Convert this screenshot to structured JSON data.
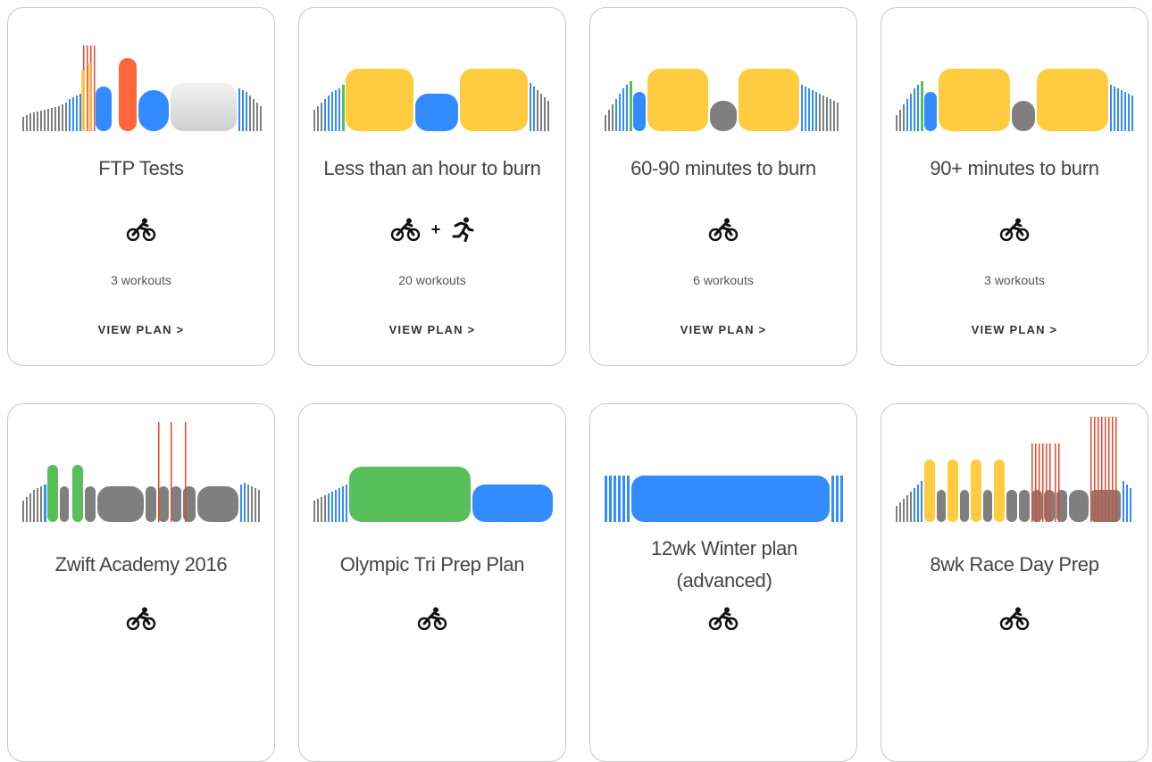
{
  "plans": [
    {
      "title": "FTP Tests",
      "sports": [
        "bike"
      ],
      "workouts": "3 workouts",
      "cta": "VIEW PLAN >"
    },
    {
      "title": "Less than an hour to burn",
      "sports": [
        "bike",
        "run"
      ],
      "workouts": "20 workouts",
      "cta": "VIEW PLAN >"
    },
    {
      "title": "60-90 minutes to burn",
      "sports": [
        "bike"
      ],
      "workouts": "6 workouts",
      "cta": "VIEW PLAN >"
    },
    {
      "title": "90+ minutes to burn",
      "sports": [
        "bike"
      ],
      "workouts": "3 workouts",
      "cta": "VIEW PLAN >"
    },
    {
      "title": "Zwift Academy 2016",
      "sports": [
        "bike"
      ]
    },
    {
      "title": "Olympic Tri Prep Plan",
      "sports": [
        "bike"
      ]
    },
    {
      "title": "12wk Winter plan (advanced)",
      "sports": [
        "bike"
      ]
    },
    {
      "title": "8wk Race Day Prep",
      "sports": [
        "bike"
      ]
    }
  ],
  "plus_sign": "+",
  "zone_colors": {
    "z1": "#7f7f7f",
    "z2": "#338cff",
    "z3": "#59bf59",
    "z4": "#ffcc3f",
    "z5": "#ff6639",
    "z6": "#e6482a",
    "free": "#dcdcdc"
  },
  "icons": {
    "bike": "cyclist-icon",
    "run": "runner-icon"
  }
}
